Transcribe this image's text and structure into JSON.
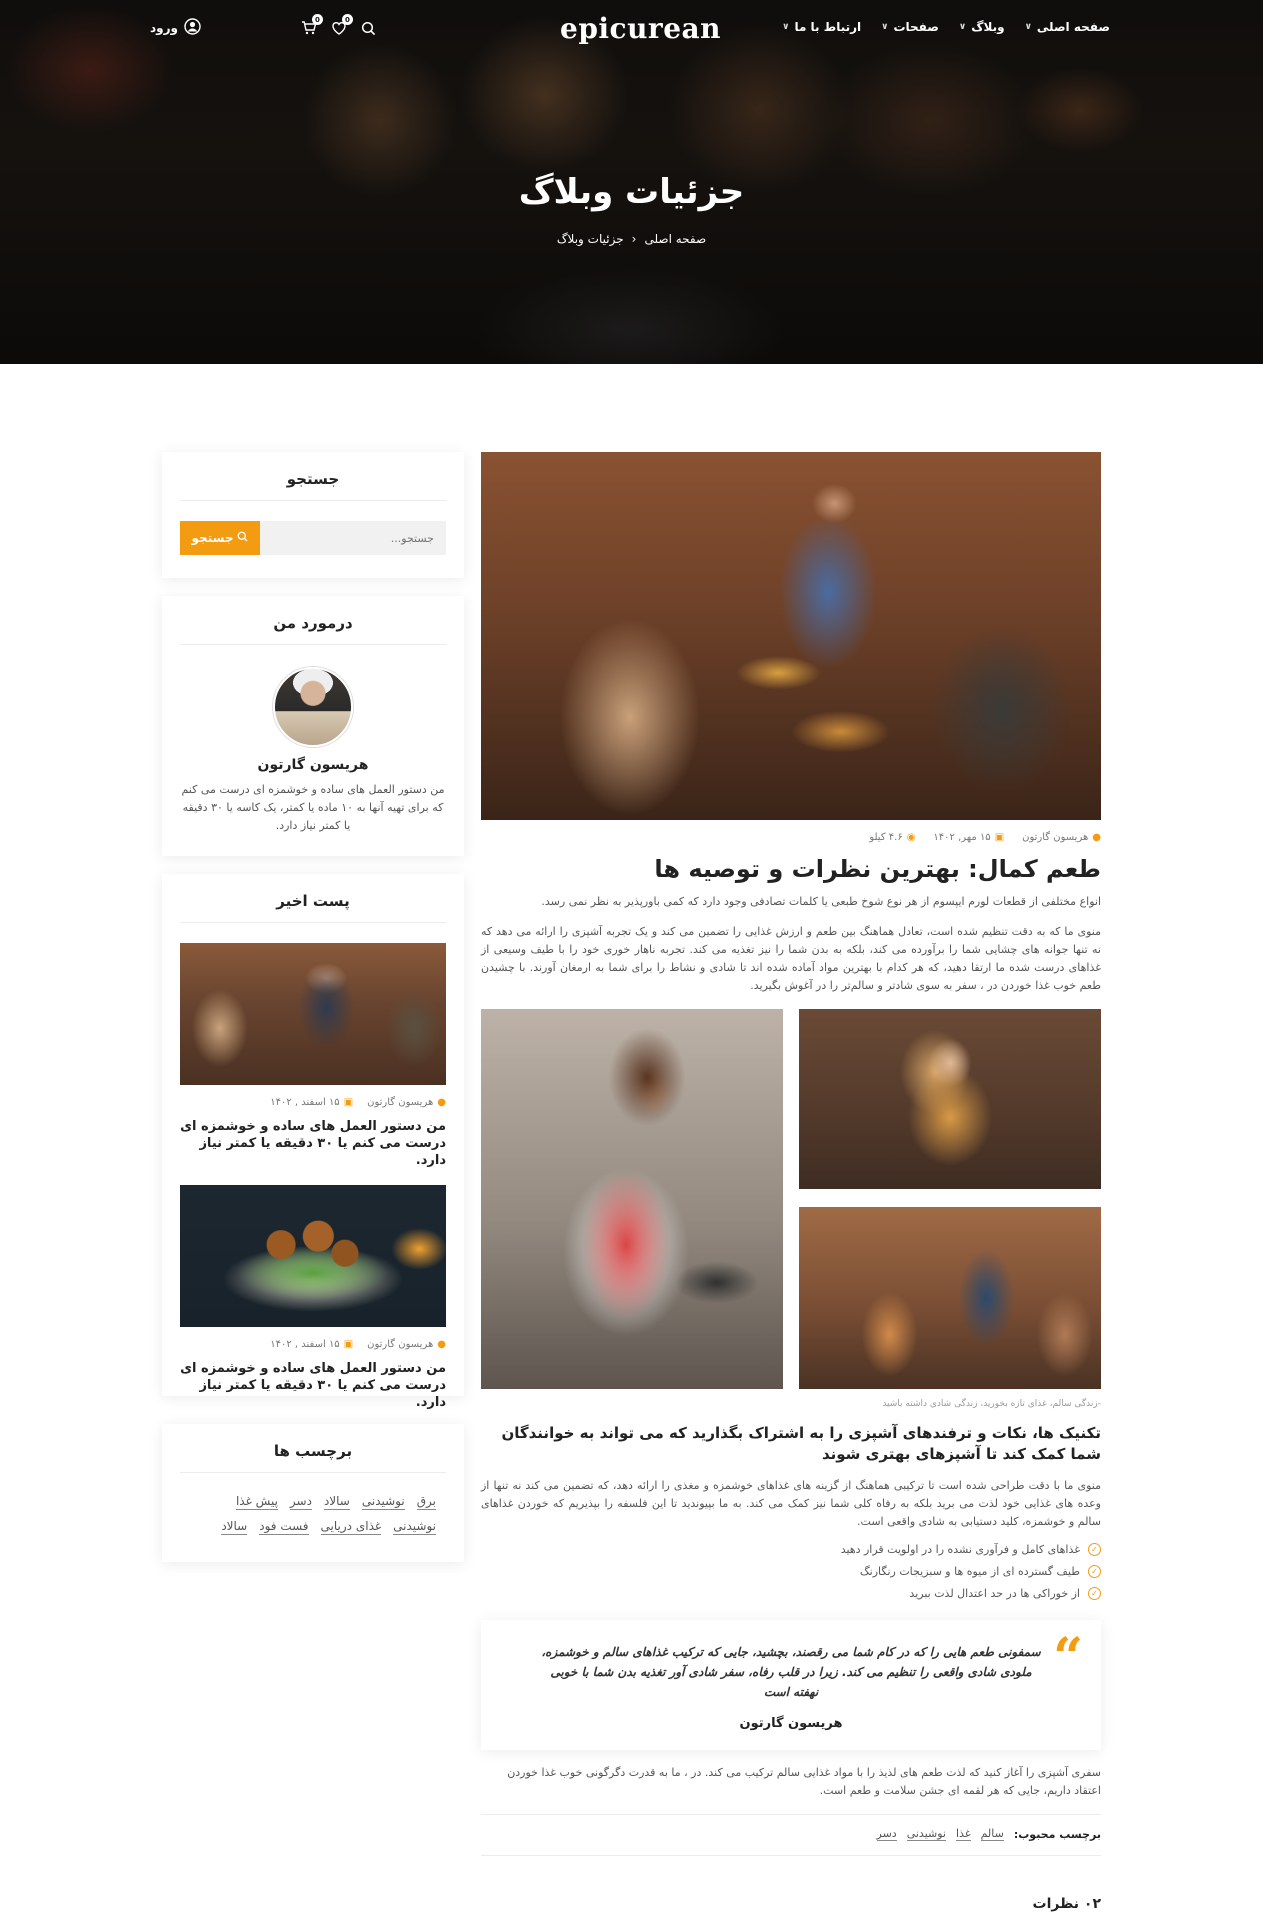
{
  "nav": {
    "logo": "epicurean",
    "menu": [
      {
        "label": "صفحه اصلی"
      },
      {
        "label": "وبلاگ"
      },
      {
        "label": "صفحات"
      },
      {
        "label": "ارتباط با ما"
      }
    ],
    "login_label": "ورود",
    "cart_count": "0",
    "wishlist_count": "0"
  },
  "hero": {
    "title": "جزئیات وبلاگ",
    "breadcrumb": [
      "صفحه اصلی",
      "جزئیات وبلاگ"
    ]
  },
  "sidebar": {
    "search": {
      "title": "جستجو",
      "placeholder": "جستجو...",
      "button": "جستجو"
    },
    "about": {
      "title": "درمورد من",
      "name": "هریسون گارتون",
      "text": "من دستور العمل های ساده و خوشمزه ای درست می کنم که برای تهیه آنها به ۱۰ ماده یا کمتر، یک کاسه یا ۳۰ دقیقه یا کمتر نیاز دارد."
    },
    "recent": {
      "title": "پست اخیر",
      "posts": [
        {
          "author": "هریسون گارتون",
          "date": "۱۵ اسفند , ۱۴۰۲",
          "title": "من دستور العمل های ساده و خوشمزه ای درست می کنم یا ۳۰ دقیقه یا کمتر نیاز دارد."
        },
        {
          "author": "هریسون گارتون",
          "date": "۱۵ اسفند , ۱۴۰۲",
          "title": "من دستور العمل های ساده و خوشمزه ای درست می کنم یا ۳۰ دقیقه یا کمتر نیاز دارد."
        }
      ]
    },
    "tags": {
      "title": "برچسب ها",
      "items": [
        "برق",
        "نوشیدنی",
        "سالاد",
        "دسر",
        "پیش غذا",
        "نوشیدنی",
        "غذای دریایی",
        "فست فود",
        "سالاد"
      ]
    }
  },
  "article": {
    "author": "هریسون گارتون",
    "date": "۱۵ مهر, ۱۴۰۲",
    "views": "۴.۶ کیلو",
    "title": "طعم کمال: بهترین نظرات و توصیه ها",
    "lead": "انواع مختلفی از قطعات لورم ایپسوم از هر نوع شوخ طبعی یا کلمات تصادفی وجود دارد که کمی باورپذیر به نظر نمی رسد.",
    "paragraph": "منوی ما که به دقت تنظیم شده است، تعادل هماهنگ بین طعم و ارزش غذایی را تضمین می کند و یک تجربه آشپزی را ارائه می دهد که نه تنها جوانه های چشایی شما را برآورده می کند، بلکه به بدن شما را نیز تغذیه می کند. تجربه ناهار خوری خود را با طیف وسیعی از غذاهای درست شده ما ارتقا دهید، که هر کدام با بهترین مواد آماده شده اند تا شادی و نشاط را برای شما به ارمغان آورند. با چشیدن طعم خوب غذا خوردن در ، سفر به سوی شادتر و سالم‌تر را در آغوش بگیرید.",
    "caption": "-زندگی سالم، غذای تازه بخورید، زندگی شادی داشته باشید",
    "subtitle": "تکنیک ها، نکات و ترفندهای آشپزی را به اشتراک بگذارید که می تواند به خوانندگان شما کمک کند تا آشپزهای بهتری شوند",
    "paragraph2": "منوی ما با دقت طراحی شده است تا ترکیبی هماهنگ از گزینه های غذاهای خوشمزه و مغذی را ارائه دهد، که تضمین می کند نه تنها از وعده های غذایی خود لذت می برید بلکه به رفاه کلی شما نیز کمک می کند. به ما بپیوندید تا این فلسفه را بپذیریم که خوردن غذاهای سالم و خوشمزه، کلید دستیابی به شادی واقعی است.",
    "checklist": [
      "غذاهای کامل و فرآوری نشده را در اولویت قرار دهید",
      "طیف گسترده ای از میوه ها و سبزیجات رنگارنگ",
      "از خوراکی ها در حد اعتدال لذت ببرید"
    ],
    "quote": {
      "text": "سمفونی طعم هایی را که در کام شما می رقصند، بچشید، جایی که ترکیب غذاهای سالم و خوشمزه، ملودی شادی واقعی را تنظیم می کند. زیرا در قلب رفاه، سفر شادی آور تغذیه بدن شما با خوبی نهفته است",
      "author": "هریسون گارتون"
    },
    "outro": "سفری آشپزی را آغاز کنید که لذت طعم های لذیذ را با مواد غذایی سالم ترکیب می کند. در ، ما به قدرت دگرگونی خوب غذا خوردن اعتقاد داریم، جایی که هر لقمه ای جشن سلامت و طعم است.",
    "fav_tags_label": "برچسب محبوب:",
    "fav_tags": [
      "سالم",
      "غذا",
      "نوشیدنی",
      "دسر"
    ],
    "comments_title": "۰۲ نظرات"
  }
}
